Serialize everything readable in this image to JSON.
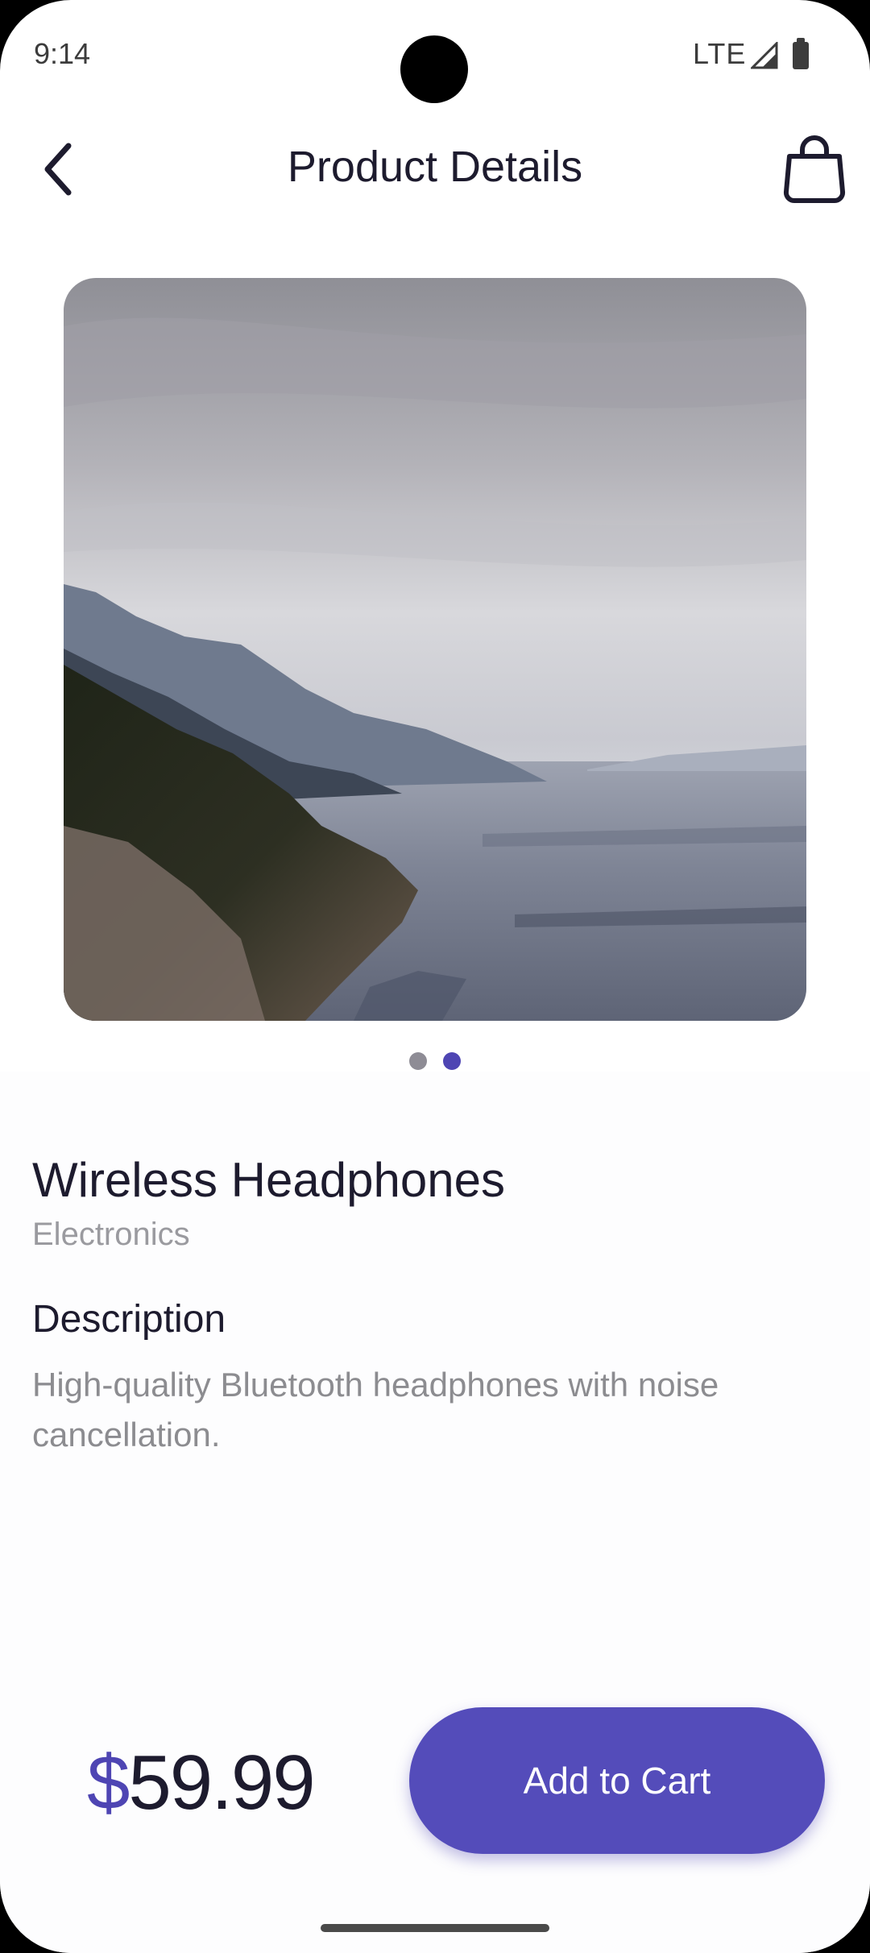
{
  "status_bar": {
    "time": "9:14",
    "network": "LTE"
  },
  "header": {
    "title": "Product Details",
    "back_icon": "chevron-left-icon",
    "cart_icon": "shopping-bag-icon"
  },
  "gallery": {
    "page_count": 2,
    "active_page": 2
  },
  "product": {
    "name": "Wireless Headphones",
    "category": "Electronics",
    "description_heading": "Description",
    "description": "High-quality Bluetooth headphones with noise cancellation.",
    "currency_symbol": "$",
    "price_value": "59.99"
  },
  "actions": {
    "add_to_cart": "Add to Cart"
  },
  "colors": {
    "accent": "#4e45b3",
    "text": "#1d1b2e",
    "muted": "#9a9a9f"
  }
}
